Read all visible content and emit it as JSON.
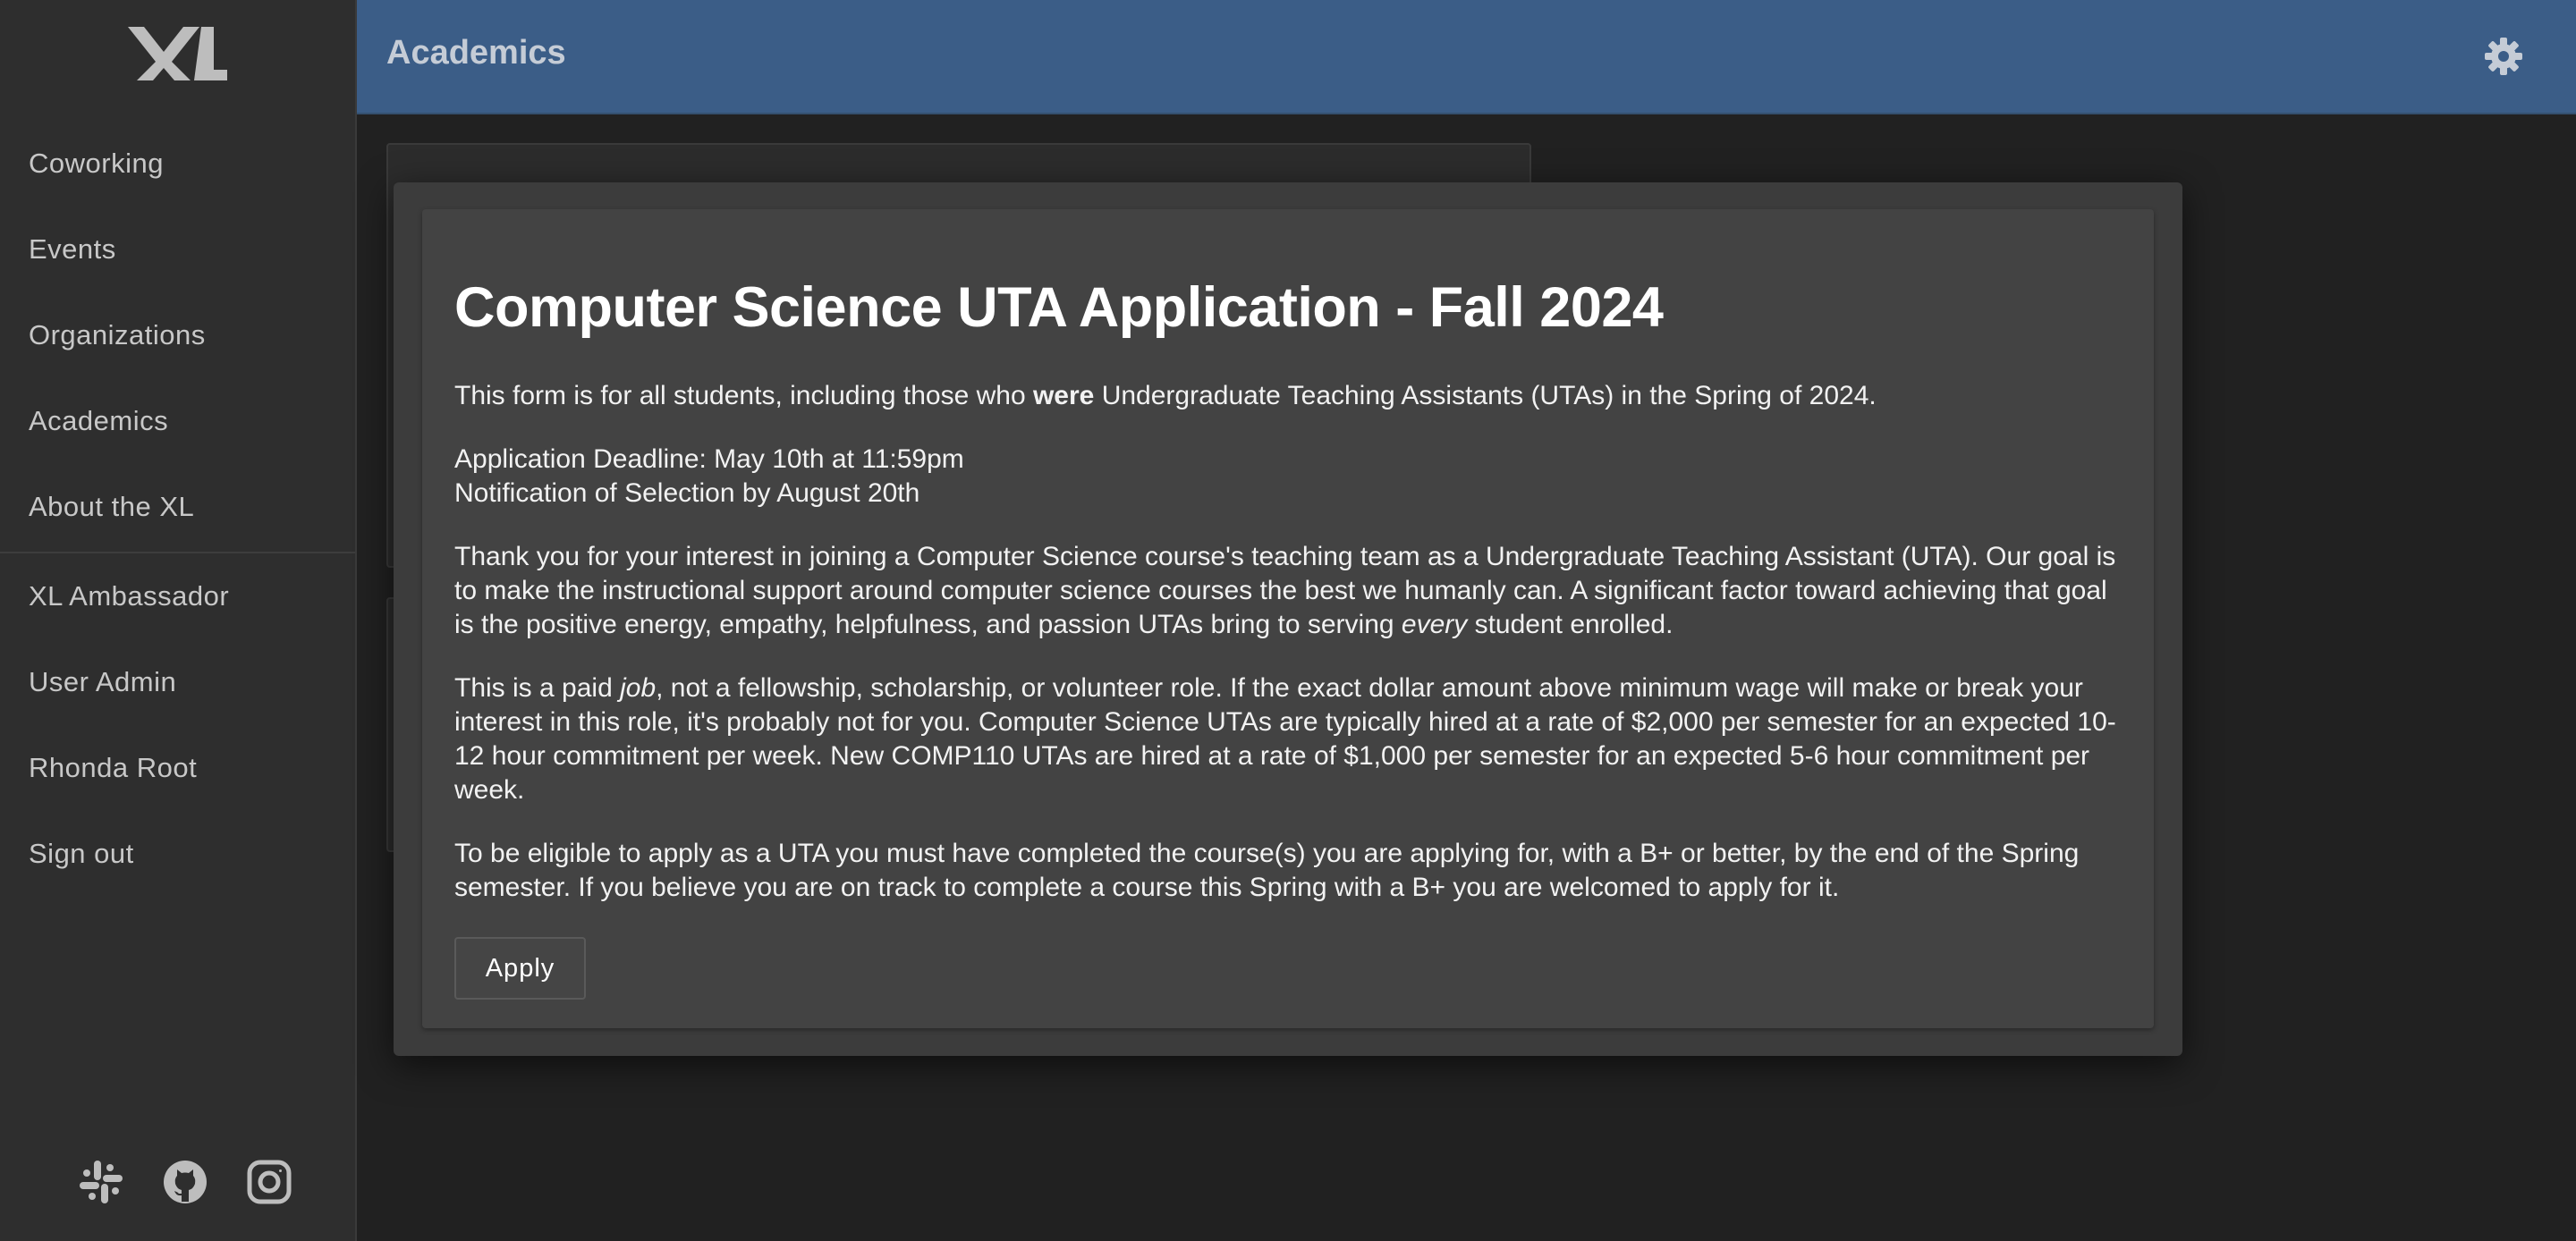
{
  "app": {
    "logo_text": "XL"
  },
  "sidebar": {
    "items": [
      {
        "label": "Coworking"
      },
      {
        "label": "Events"
      },
      {
        "label": "Organizations"
      },
      {
        "label": "Academics"
      },
      {
        "label": "About the XL"
      },
      {
        "label": "XL Ambassador"
      },
      {
        "label": "User Admin"
      },
      {
        "label": "Rhonda Root"
      },
      {
        "label": "Sign out"
      }
    ],
    "social_icons": [
      "slack-icon",
      "github-icon",
      "instagram-icon"
    ]
  },
  "header": {
    "title": "Academics",
    "icon": "gear-icon",
    "color": "#3b5d87"
  },
  "modal": {
    "title": "Computer Science UTA Application - Fall 2024",
    "p1_pre": "This form is for all students, including those who ",
    "p1_bold": "were",
    "p1_post": " Undergraduate Teaching Assistants (UTAs) in the Spring of 2024.",
    "deadline": "Application Deadline: May 10th at 11:59pm",
    "notification": "Notification of Selection by August 20th",
    "p3_pre": "Thank you for your interest in joining a Computer Science course's teaching team as a Undergraduate Teaching Assistant (UTA). Our goal is to make the instructional support around computer science courses the best we humanly can. A significant factor toward achieving that goal is the positive energy, empathy, helpfulness, and passion UTAs bring to serving ",
    "p3_em": "every",
    "p3_post": " student enrolled.",
    "p4_pre": "This is a paid ",
    "p4_em": "job",
    "p4_post": ", not a fellowship, scholarship, or volunteer role. If the exact dollar amount above minimum wage will make or break your interest in this role, it's probably not for you. Computer Science UTAs are typically hired at a rate of $2,000 per semester for an expected 10-12 hour commitment per week. New COMP110 UTAs are hired at a rate of $1,000 per semester for an expected 5-6 hour commitment per week.",
    "p5": "To be eligible to apply as a UTA you must have completed the course(s) you are applying for, with a B+ or better, by the end of the Spring semester. If you believe you are on track to complete a course this Spring with a B+ you are welcomed to apply for it.",
    "apply_label": "Apply"
  }
}
